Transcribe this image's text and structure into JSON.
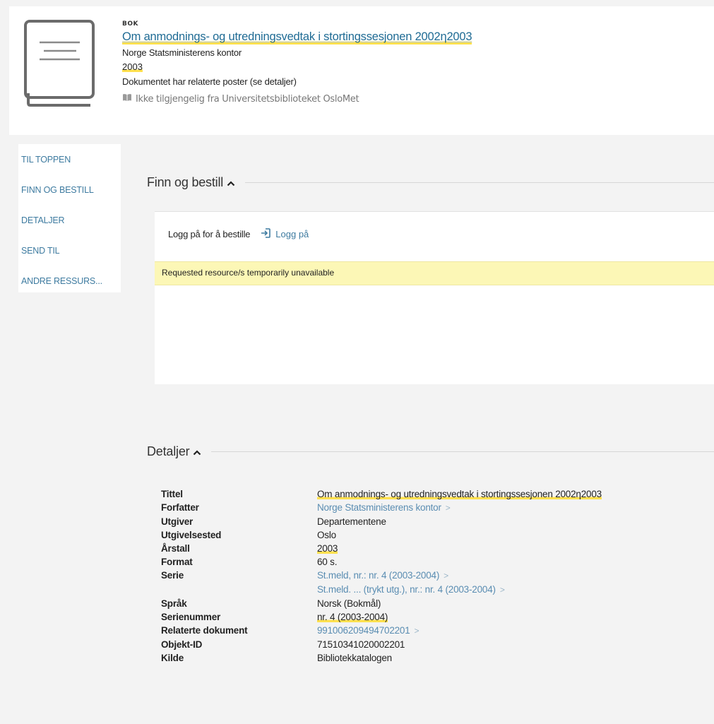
{
  "record": {
    "type": "BOK",
    "title": "Om anmodnings- og utredningsvedtak i stortingssesjonen 2002η2003",
    "author": "Norge Statsministerens kontor",
    "year": "2003",
    "related_note": "Dokumentet har relaterte poster (se detaljer)",
    "availability": "Ikke tilgjengelig fra Universitetsbiblioteket OsloMet"
  },
  "side_nav": {
    "items": [
      "TIL TOPPEN",
      "FINN OG BESTILL",
      "DETALJER",
      "SEND TIL",
      "ANDRE RESSURS..."
    ]
  },
  "getit": {
    "heading": "Finn og bestill",
    "login_prompt": "Logg på for å bestille",
    "login_link": "Logg på",
    "notice": "Requested resource/s temporarily unavailable"
  },
  "details": {
    "heading": "Detaljer",
    "rows": {
      "title": {
        "label": "Tittel",
        "value": "Om anmodnings- og utredningsvedtak i stortingssesjonen 2002η2003"
      },
      "author": {
        "label": "Forfatter",
        "value": "Norge Statsministerens kontor"
      },
      "publisher": {
        "label": "Utgiver",
        "value": "Departementene"
      },
      "place": {
        "label": "Utgivelsested",
        "value": "Oslo"
      },
      "year": {
        "label": "Årstall",
        "value": "2003"
      },
      "format": {
        "label": "Format",
        "value": "60 s."
      },
      "series": {
        "label": "Serie",
        "values": [
          "St.meld, nr.: nr. 4 (2003-2004)",
          "St.meld. ... (trykt utg.), nr.: nr. 4 (2003-2004)"
        ]
      },
      "language": {
        "label": "Språk",
        "value": "Norsk (Bokmål)"
      },
      "series_number": {
        "label": "Serienummer",
        "value": "nr. 4 (2003-2004)"
      },
      "related": {
        "label": "Relaterte dokument",
        "value": "991006209494702201"
      },
      "object_id": {
        "label": "Objekt-ID",
        "value": "71510341020002201"
      },
      "source": {
        "label": "Kilde",
        "value": "Bibliotekkatalogen"
      }
    }
  },
  "colors": {
    "link": "#1f6b94",
    "highlight": "#ffe04f",
    "notice_bg": "#fcf7b6",
    "page_bg": "#f3f3f3"
  },
  "icons": {
    "thumbnail": "book-thumbnail-icon",
    "availability": "book-open-icon",
    "login": "sign-in-icon",
    "chevron": "chevron-right-icon",
    "collapse": "chevron-up-icon"
  }
}
